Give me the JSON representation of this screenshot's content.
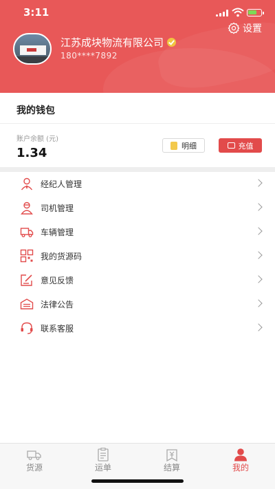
{
  "status_bar": {
    "time": "3:11"
  },
  "header": {
    "settings_label": "设置",
    "company_name": "江苏成块物流有限公司",
    "phone": "180****7892"
  },
  "wallet": {
    "title": "我的钱包",
    "balance_label": "账户余额 (元)",
    "balance_value": "1.34",
    "detail_label": "明细",
    "recharge_label": "充值"
  },
  "menu": {
    "items": [
      {
        "label": "经纪人管理",
        "icon": "broker-icon"
      },
      {
        "label": "司机管理",
        "icon": "driver-icon"
      },
      {
        "label": "车辆管理",
        "icon": "truck-icon"
      },
      {
        "label": "我的货源码",
        "icon": "qr-code-icon"
      },
      {
        "label": "意见反馈",
        "icon": "feedback-icon"
      },
      {
        "label": "法律公告",
        "icon": "legal-notice-icon"
      },
      {
        "label": "联系客服",
        "icon": "headset-icon"
      }
    ]
  },
  "tabs": [
    {
      "label": "货源",
      "icon": "truck-icon",
      "active": false
    },
    {
      "label": "运单",
      "icon": "waybill-icon",
      "active": false
    },
    {
      "label": "结算",
      "icon": "settlement-icon",
      "active": false
    },
    {
      "label": "我的",
      "icon": "user-icon",
      "active": true
    }
  ],
  "colors": {
    "brand": "#e85858",
    "accent": "#e24b4b"
  }
}
